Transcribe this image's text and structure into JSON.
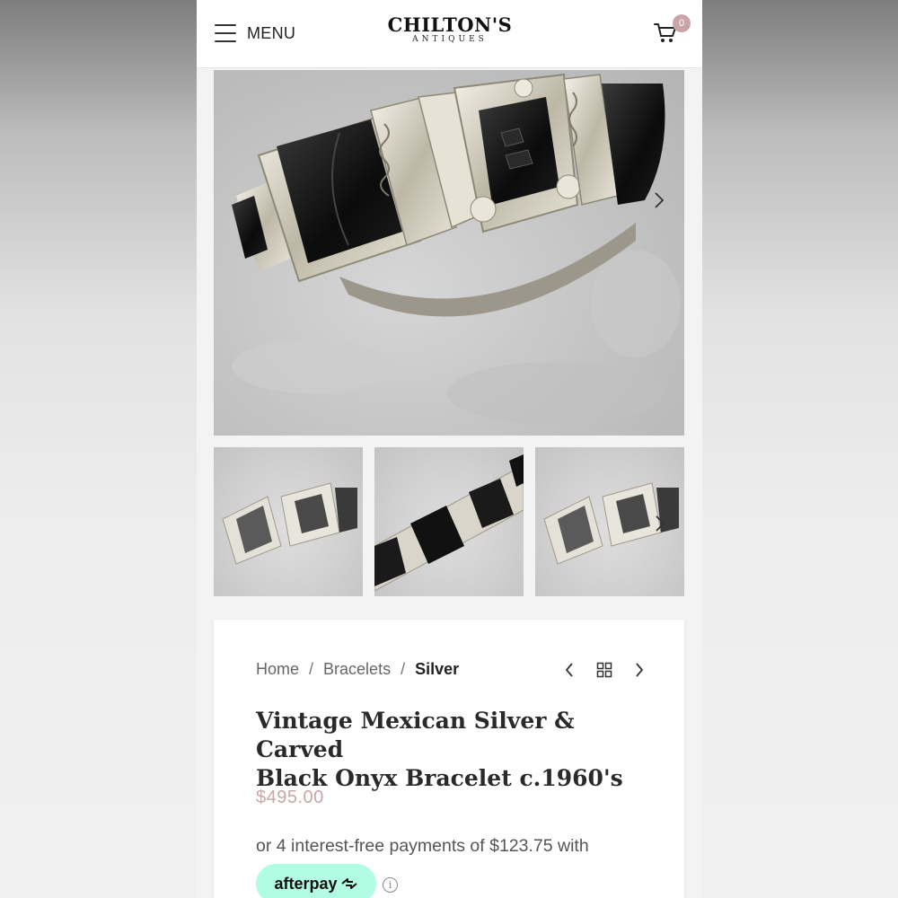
{
  "header": {
    "menu_label": "MENU",
    "logo_main": "CHILTON'S",
    "logo_sub": "ANTIQUES",
    "cart_count": "0"
  },
  "gallery": {
    "main_image": "silver and black onyx bracelet photo",
    "thumbnails": [
      "bracelet side view",
      "bracelet flat view",
      "bracelet side view"
    ]
  },
  "breadcrumb": {
    "home": "Home",
    "category": "Bracelets",
    "current": "Silver",
    "separator": "/"
  },
  "product": {
    "title_line1": "Vintage Mexican Silver & Carved",
    "title_line2": "Black Onyx Bracelet c.1960's",
    "price": "$495.00",
    "installment_text": "or 4 interest-free payments of $123.75 with",
    "afterpay_label": "afterpay",
    "info_symbol": "i"
  },
  "colors": {
    "price": "#c7a7a9",
    "afterpay_bg": "#b2fce4",
    "cart_badge": "#c9a5a8"
  }
}
